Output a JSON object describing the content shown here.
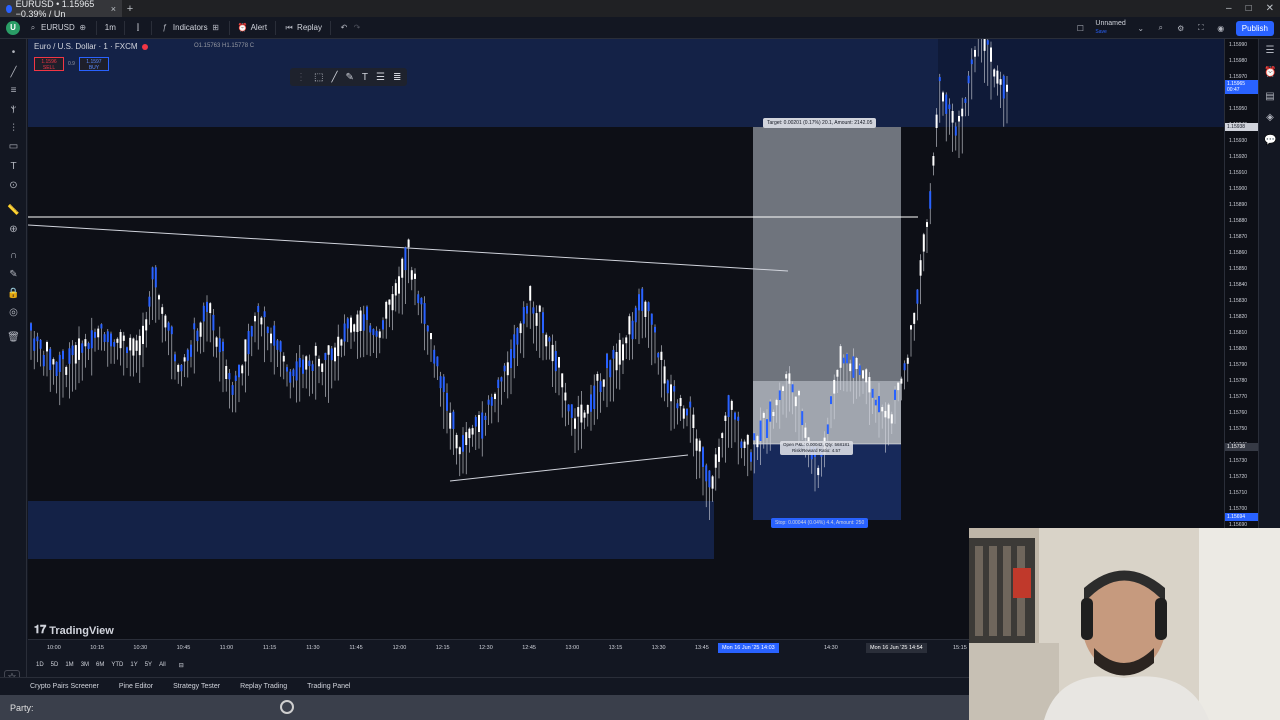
{
  "browser": {
    "tab_title": "EURUSD • 1.15965 −0.39% / Un",
    "tab_close": "×",
    "new_tab": "+"
  },
  "toolbar": {
    "logo": "U",
    "symbol": "EURUSD",
    "interval": "1m",
    "indicators": "Indicators",
    "alert": "Alert",
    "replay": "Replay",
    "layout_name": "Unnamed",
    "layout_sub": "Save",
    "publish": "Publish"
  },
  "chart": {
    "title": "Euro / U.S. Dollar · 1 · FXCM",
    "ohlc": "O1.15763 H1.15778 C",
    "sell_price": "1.1596",
    "sell_label": "SELL",
    "spread": "0.9",
    "buy_price": "1.1597",
    "buy_label": "BUY",
    "target_label": "Target: 0.00201 (0.17%) 20.1, Amount: 2142.05",
    "open_label_1": "Open P&L: 0.00042, Qty: 568181",
    "open_label_2": "Risk/Reward Ratio: 4.57",
    "stop_label": "Stop: 0.00044 (0.04%) 4.4, Amount: 250",
    "watermark": "TradingView",
    "accent": "#2962ff",
    "band_color": "#142247"
  },
  "price_axis": {
    "labels": [
      "1.15990",
      "1.15980",
      "1.15970",
      "1.15960",
      "1.15950",
      "1.15940",
      "1.15930",
      "1.15920",
      "1.15910",
      "1.15900",
      "1.15890",
      "1.15880",
      "1.15870",
      "1.15860",
      "1.15850",
      "1.15840",
      "1.15830",
      "1.15820",
      "1.15810",
      "1.15800",
      "1.15790",
      "1.15780",
      "1.15770",
      "1.15760",
      "1.15750",
      "1.15740",
      "1.15730",
      "1.15720",
      "1.15710",
      "1.15700",
      "1.15690"
    ],
    "current_price": "1.15965",
    "current_time": "00:47",
    "marker_price": "1.15938",
    "crosshair_price": "1.15738",
    "stop_price": "1.15694"
  },
  "time_axis": {
    "labels": [
      "10:00",
      "10:15",
      "10:30",
      "10:45",
      "11:00",
      "11:15",
      "11:30",
      "11:45",
      "12:00",
      "12:15",
      "12:30",
      "12:45",
      "13:00",
      "13:15",
      "13:30",
      "13:45",
      "14:30",
      "15:15"
    ],
    "entry_badge": "Mon 16 Jun '25  14:03",
    "exit_badge": "Mon 16 Jun '25  14:54"
  },
  "ranges": [
    "1D",
    "5D",
    "1M",
    "3M",
    "6M",
    "YTD",
    "1Y",
    "5Y",
    "All"
  ],
  "bottom_tabs": [
    "Crypto Pairs Screener",
    "Pine Editor",
    "Strategy Tester",
    "Replay Trading",
    "Trading Panel"
  ],
  "taskbar": {
    "label": "Party:"
  }
}
